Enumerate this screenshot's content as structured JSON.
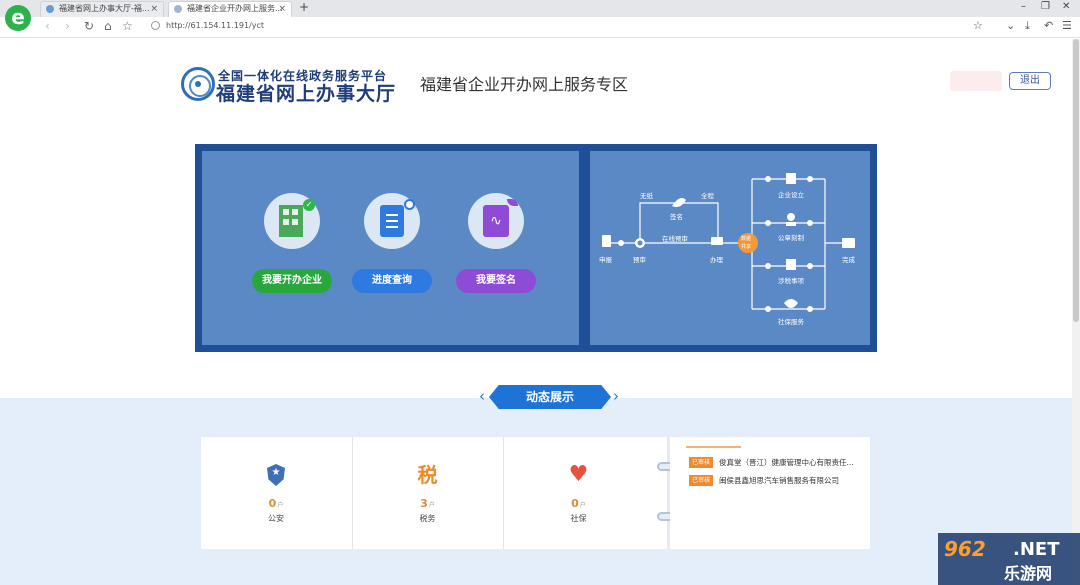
{
  "browser": {
    "logo": "e",
    "tabs": [
      {
        "label": "福建省网上办事大厅-福..."
      },
      {
        "label": "福建省企业开办网上服务..."
      }
    ],
    "tab_close": "×",
    "new_tab": "+",
    "url": "http://61.154.11.191/yct",
    "nav": {
      "back": "‹",
      "forward": "›",
      "reload": "↻",
      "home": "⌂",
      "star": "☆"
    },
    "right_icons": {
      "star": "☆",
      "chevron": "⌄",
      "download": "⤓",
      "undo": "↶",
      "menu": "☰"
    },
    "window_controls": {
      "minimize": "–",
      "restore": "❐",
      "close": "✕"
    }
  },
  "header": {
    "logo_line1": "全国一体化在线政务服务平台",
    "logo_line2": "福建省网上办事大厅",
    "zone_title": "福建省企业开办网上服务专区",
    "logout": "退出"
  },
  "features": [
    {
      "label": "我要开办企业",
      "icon": "building-check-icon",
      "color": "#27a73c"
    },
    {
      "label": "进度查询",
      "icon": "document-search-icon",
      "color": "#2e7ae0"
    },
    {
      "label": "我要签名",
      "icon": "tablet-signature-icon",
      "color": "#8e4bd6"
    }
  ],
  "flow": {
    "start": "申报",
    "review": "预审",
    "sign": "签名",
    "paperless": "无纸",
    "all_process": "全程",
    "online_review": "在线预审",
    "handle": "办理",
    "center_top": "数据",
    "center_bottom": "共享",
    "branches": [
      "企业设立",
      "公章刻制",
      "涉税事项",
      "社保服务"
    ],
    "finish": "完成"
  },
  "dynamic": {
    "title": "动态展示",
    "stats": [
      {
        "value": "0",
        "unit": "户",
        "label": "公安",
        "icon": "police-badge-icon"
      },
      {
        "value": "3",
        "unit": "户",
        "label": "税务",
        "icon": "tax-icon"
      },
      {
        "value": "0",
        "unit": "户",
        "label": "社保",
        "icon": "social-care-icon"
      }
    ],
    "notices": [
      {
        "tag": "已审核",
        "text": "俊真堂（晋江）健康管理中心有限责任..."
      },
      {
        "tag": "已审核",
        "text": "闽侯县鑫旭思汽车销售服务有限公司"
      }
    ]
  },
  "watermark": {
    "number": "962",
    "suffix": ".NET",
    "name": "乐游网"
  },
  "colors": {
    "banner_bg": "#1f4f96",
    "panel_bg": "#5b89c6",
    "section_bg": "#e4eefa",
    "accent": "#1d74d6"
  }
}
